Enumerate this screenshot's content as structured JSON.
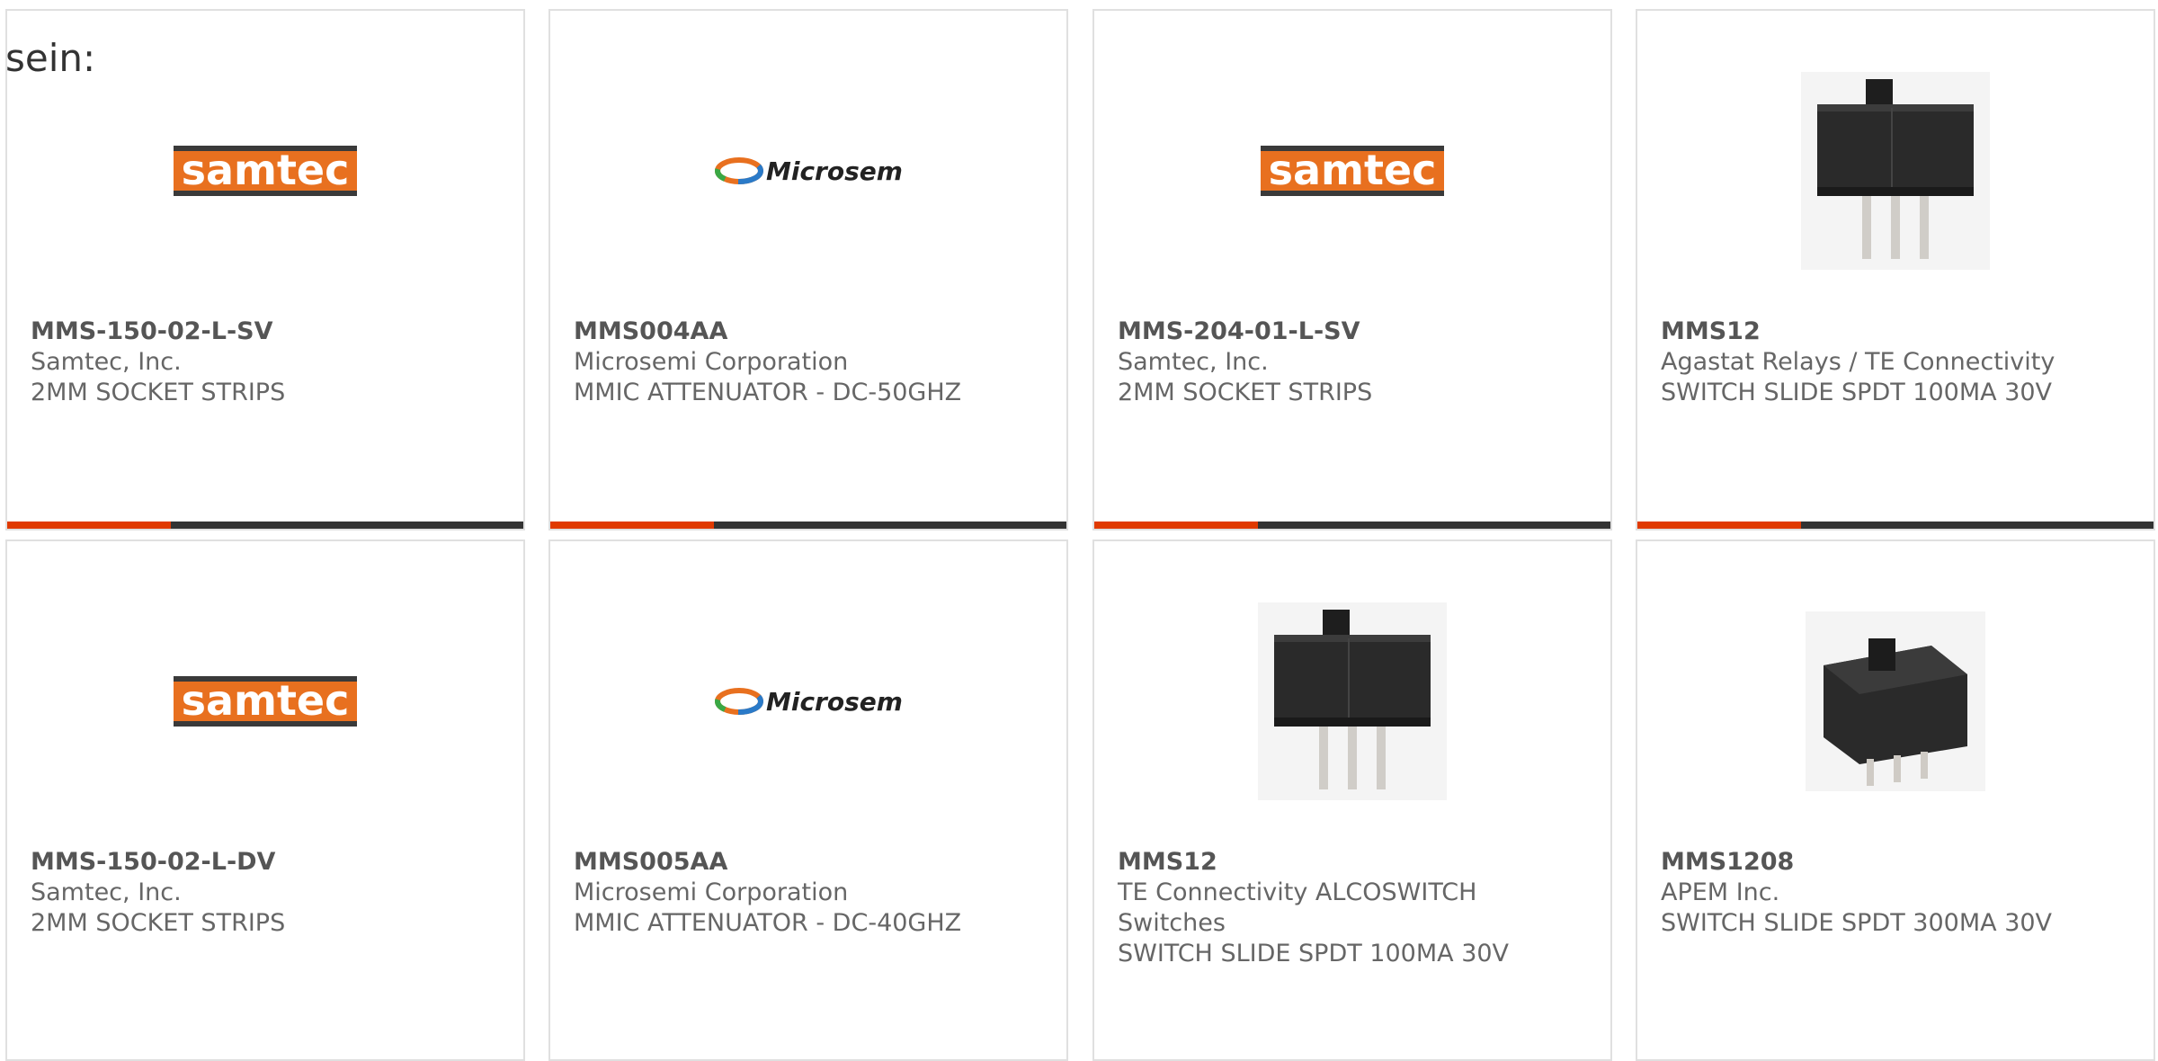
{
  "intro_text": "sein:",
  "colors": {
    "accent": "#e03a00",
    "bar": "#333333",
    "samtec_orange": "#e8701f",
    "samtec_dark": "#3a3a3a"
  },
  "products": [
    {
      "part_number": "MMS-150-02-L-SV",
      "manufacturer": "Samtec, Inc.",
      "description": "2MM SOCKET STRIPS",
      "image": "samtec-logo"
    },
    {
      "part_number": "MMS004AA",
      "manufacturer": "Microsemi Corporation",
      "description": "MMIC ATTENUATOR - DC-50GHZ",
      "image": "microsemi-logo"
    },
    {
      "part_number": "MMS-204-01-L-SV",
      "manufacturer": "Samtec, Inc.",
      "description": "2MM SOCKET STRIPS",
      "image": "samtec-logo"
    },
    {
      "part_number": "MMS12",
      "manufacturer": "Agastat Relays / TE Connectivity",
      "description": "SWITCH SLIDE SPDT 100MA 30V",
      "image": "slide-switch-photo"
    },
    {
      "part_number": "MMS-150-02-L-DV",
      "manufacturer": "Samtec, Inc.",
      "description": "2MM SOCKET STRIPS",
      "image": "samtec-logo"
    },
    {
      "part_number": "MMS005AA",
      "manufacturer": "Microsemi Corporation",
      "description": "MMIC ATTENUATOR - DC-40GHZ",
      "image": "microsemi-logo"
    },
    {
      "part_number": "MMS12",
      "manufacturer": "TE Connectivity ALCOSWITCH Switches",
      "description": "SWITCH SLIDE SPDT 100MA 30V",
      "image": "slide-switch-photo"
    },
    {
      "part_number": "MMS1208",
      "manufacturer": "APEM Inc.",
      "description": "SWITCH SLIDE SPDT 300MA 30V",
      "image": "slide-switch-photo"
    }
  ],
  "logos": {
    "samtec": "samtec",
    "microsemi": "Microsemi"
  }
}
